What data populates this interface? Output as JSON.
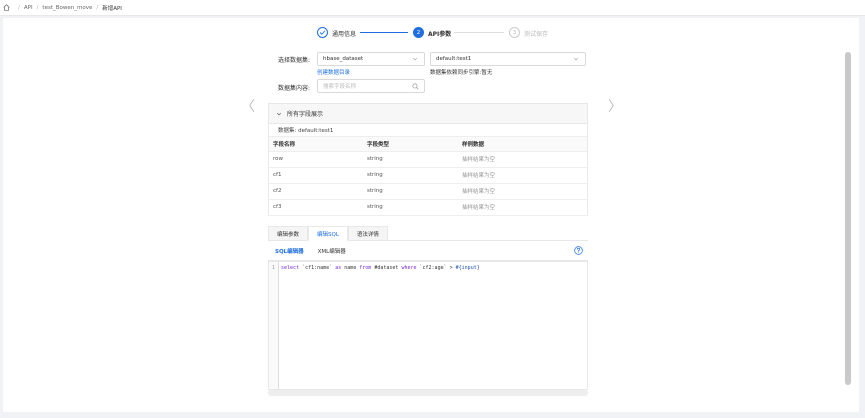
{
  "breadcrumb": {
    "items": [
      "API",
      "test_Bowen_move",
      "新增API"
    ]
  },
  "steps": [
    {
      "label": "通用信息",
      "number": "✓",
      "state": "done"
    },
    {
      "label": "API参数",
      "number": "2",
      "state": "active"
    },
    {
      "label": "测试保存",
      "number": "3",
      "state": "pending"
    }
  ],
  "form": {
    "dataset_label": "选择数据集:",
    "dataset_value": "hbase_dataset",
    "table_value": "default:test1",
    "create_link": "创建数据目录",
    "sync_note": "数据集依赖同步引擎:暂无",
    "content_label": "数据集内容:",
    "search_placeholder": "搜索字段名称"
  },
  "fields_panel": {
    "title": "所有字段展示",
    "dataset_line": "数据集: default:test1",
    "columns": [
      "字段名称",
      "字段类型",
      "样例数据"
    ],
    "rows": [
      [
        "row",
        "string",
        "抽样结果为空"
      ],
      [
        "cf1",
        "string",
        "抽样结果为空"
      ],
      [
        "cf2",
        "string",
        "抽样结果为空"
      ],
      [
        "cf3",
        "string",
        "抽样结果为空"
      ]
    ]
  },
  "editor": {
    "tabs": [
      "编辑参数",
      "编辑SQL",
      "语法详情"
    ],
    "subtabs": [
      "SQL编辑器",
      "XML编辑器"
    ],
    "line_number": "1",
    "code": {
      "t1": "select",
      "t2": " `cf1:name` ",
      "t3": "as",
      "t4": " name ",
      "t5": "from",
      "t6": " #dataset ",
      "t7": "where",
      "t8": " `cf2:age` > ",
      "t9": "#{input}"
    }
  },
  "colors": {
    "accent": "#1f6fe0",
    "border": "#e8e8e8"
  }
}
